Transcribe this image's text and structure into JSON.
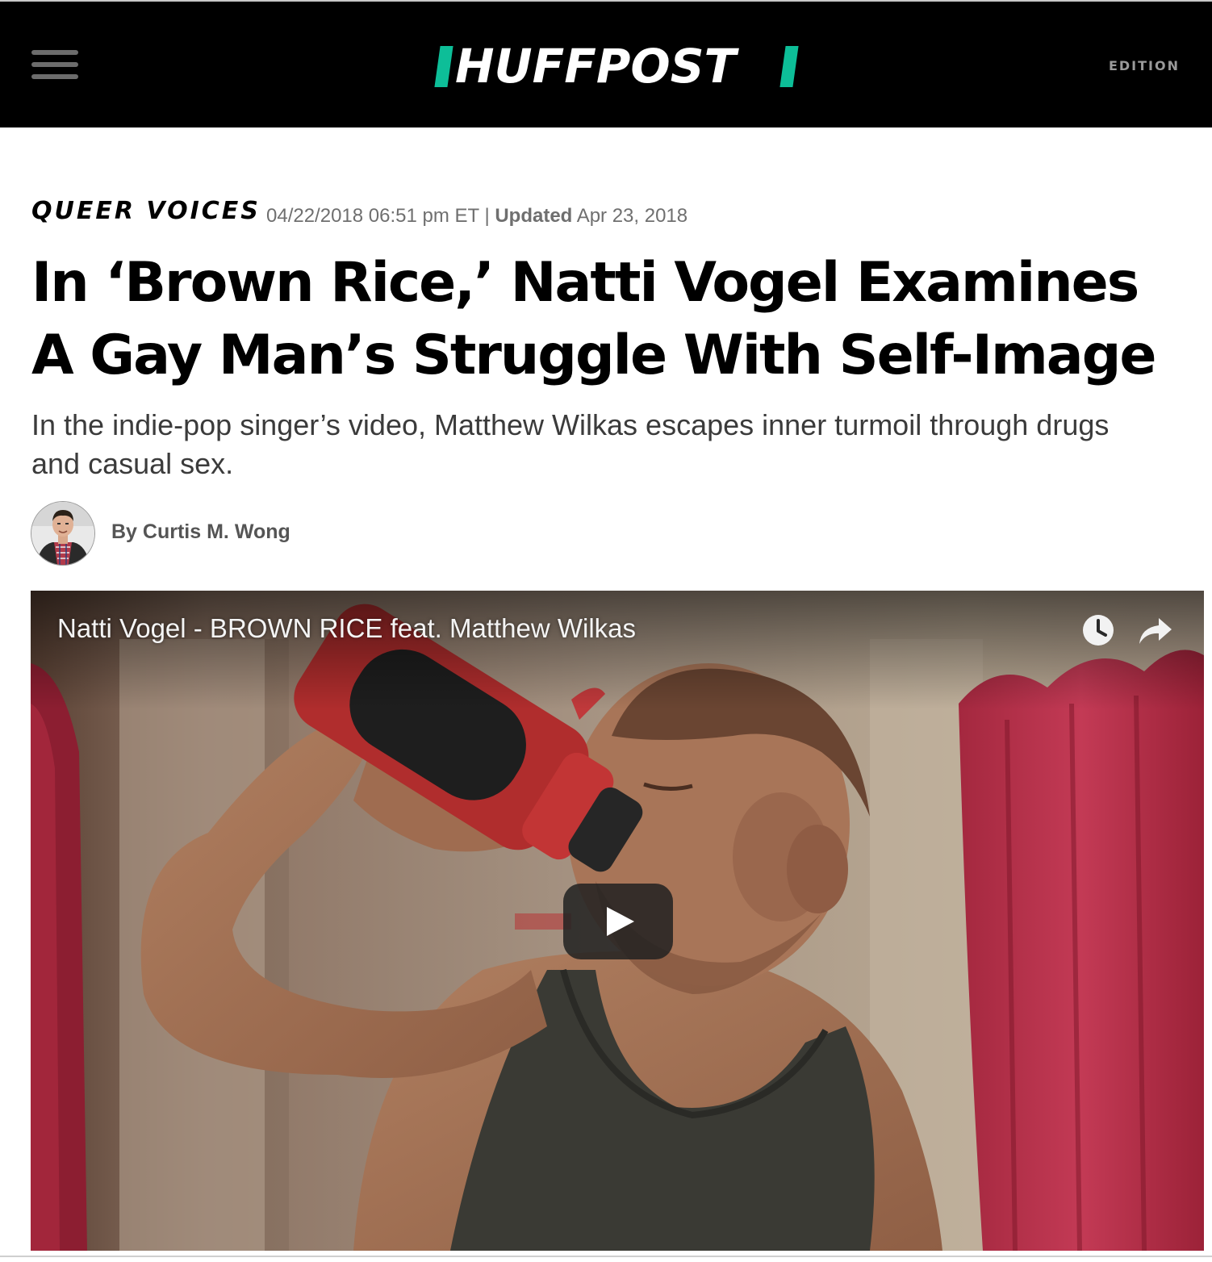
{
  "header": {
    "logo_text": "HUFFPOST",
    "edition_label": "EDITION",
    "accent_color": "#0dbe98",
    "menu_icon": "hamburger-menu-icon"
  },
  "article": {
    "section": "QUEER VOICES",
    "timestamp": "04/22/2018 06:51 pm ET",
    "separator": "|",
    "updated_label": "Updated",
    "updated_date": "Apr 23, 2018",
    "headline": "In ‘Brown Rice,’ Natti Vogel Examines A Gay Man’s Struggle With Self-Image",
    "dek": "In the indie-pop singer’s video, Matthew Wilkas escapes inner turmoil through drugs and casual sex.",
    "byline_prefix": "By",
    "author": "Curtis M. Wong"
  },
  "video": {
    "title": "Natti Vogel - BROWN RICE feat. Matthew Wilkas",
    "icons": [
      "clock-icon",
      "share-arrow-icon",
      "play-icon"
    ]
  }
}
